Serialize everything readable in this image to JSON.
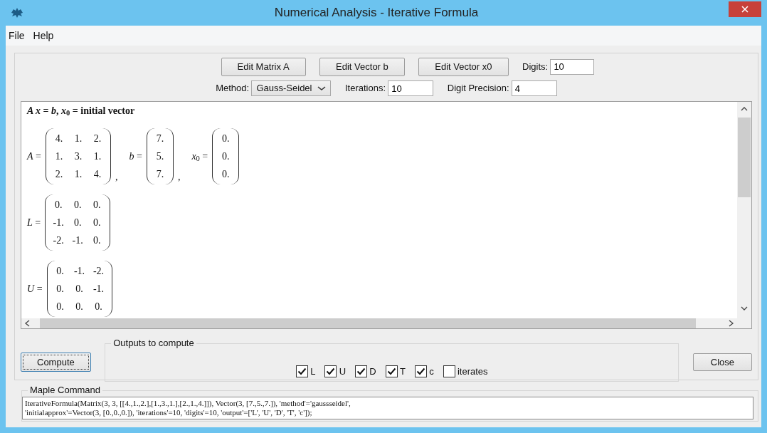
{
  "window": {
    "title": "Numerical Analysis - Iterative Formula"
  },
  "menu": [
    "File",
    "Help"
  ],
  "top_buttons": [
    "Edit Matrix A",
    "Edit Vector b",
    "Edit Vector x0"
  ],
  "digits": {
    "label": "Digits:",
    "value": "10"
  },
  "method": {
    "label": "Method:",
    "value": "Gauss-Seidel"
  },
  "iterations": {
    "label": "Iterations:",
    "value": "10"
  },
  "digit_precision": {
    "label": "Digit Precision:",
    "value": "4"
  },
  "output_area": {
    "header": "*A x* = *b*,  *x*$_{0}$ = initial vector",
    "lines": [
      [
        {
          "label": "*A* =",
          "matrix": [
            [
              "4.",
              "1.",
              "2."
            ],
            [
              "1.",
              "3.",
              "1."
            ],
            [
              "2.",
              "1.",
              "4."
            ]
          ],
          "trailing": ","
        },
        {
          "label": "*b* =",
          "matrix": [
            [
              "7."
            ],
            [
              "5."
            ],
            [
              "7."
            ]
          ],
          "trailing": ","
        },
        {
          "label": "*x*$_{0}$ =",
          "matrix": [
            [
              "0."
            ],
            [
              "0."
            ],
            [
              "0."
            ]
          ]
        }
      ],
      [
        {
          "label": "*L* =",
          "matrix": [
            [
              "0.",
              "0.",
              "0."
            ],
            [
              "-1.",
              "0.",
              "0."
            ],
            [
              "-2.",
              "-1.",
              "0."
            ]
          ]
        }
      ],
      [
        {
          "label": "*U* =",
          "matrix": [
            [
              "0.",
              "-1.",
              "-2."
            ],
            [
              "0.",
              "0.",
              "-1."
            ],
            [
              "0.",
              "0.",
              "0."
            ]
          ]
        }
      ]
    ]
  },
  "compute_button": "Compute",
  "outputs": {
    "title": "Outputs to compute",
    "items": [
      {
        "label": "L",
        "checked": true
      },
      {
        "label": "U",
        "checked": true
      },
      {
        "label": "D",
        "checked": true
      },
      {
        "label": "T",
        "checked": true
      },
      {
        "label": "c",
        "checked": true
      },
      {
        "label": "iterates",
        "checked": false
      }
    ]
  },
  "close_button": "Close",
  "maple_command": {
    "title": "Maple Command",
    "lines": [
      "IterativeFormula(Matrix(3, 3, [[4.,1.,2.],[1.,3.,1.],[2.,1.,4.]]), Vector(3, [7.,5.,7.]), 'method'='gaussseidel',",
      "'initialapprox'=Vector(3, [0.,0.,0.]), 'iterations'=10, 'digits'=10, 'output'=['L', 'U', 'D', 'T', 'c']);"
    ]
  }
}
